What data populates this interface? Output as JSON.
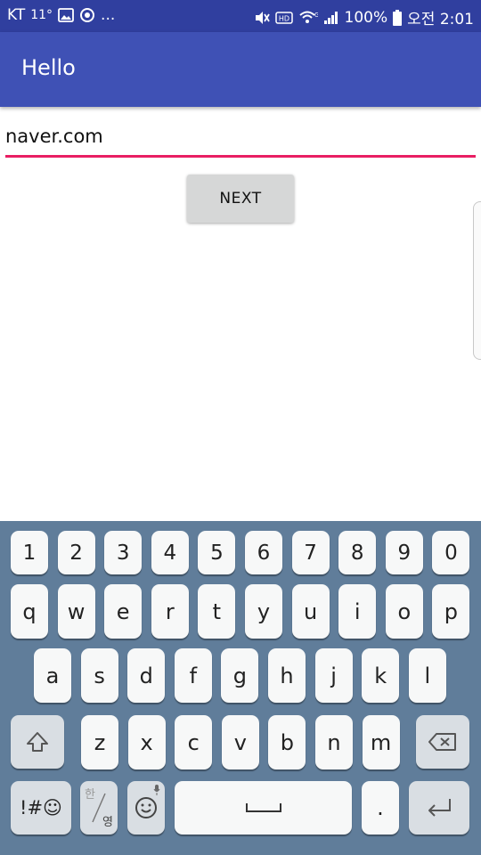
{
  "status_bar": {
    "carrier": "KT",
    "temperature": "11°",
    "battery": "100%",
    "time": "오전 2:01",
    "dots": "..."
  },
  "toolbar": {
    "title": "Hello"
  },
  "url_input": {
    "value": "naver.com"
  },
  "next_button": {
    "label": "NEXT"
  },
  "keyboard": {
    "row_numbers": [
      "1",
      "2",
      "3",
      "4",
      "5",
      "6",
      "7",
      "8",
      "9",
      "0"
    ],
    "row_top": [
      "q",
      "w",
      "e",
      "r",
      "t",
      "y",
      "u",
      "i",
      "o",
      "p"
    ],
    "row_middle": [
      "a",
      "s",
      "d",
      "f",
      "g",
      "h",
      "j",
      "k",
      "l"
    ],
    "row_bottom": [
      "z",
      "x",
      "c",
      "v",
      "b",
      "n",
      "m"
    ],
    "symbols_label": "!#☺",
    "lang_top": "한",
    "lang_bottom": "영",
    "period": "."
  },
  "colors": {
    "status_bar": "#303F9F",
    "toolbar": "#3F51B5",
    "accent": "#E91E63",
    "keyboard_bg": "#607D9A"
  }
}
